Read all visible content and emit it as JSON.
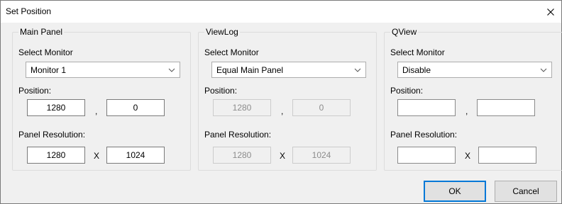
{
  "window": {
    "title": "Set Position"
  },
  "groups": [
    {
      "title": "Main Panel",
      "select_monitor_label": "Select Monitor",
      "monitor_value": "Monitor 1",
      "position_label": "Position:",
      "position_x": "1280",
      "position_sep": ",",
      "position_y": "0",
      "resolution_label": "Panel Resolution:",
      "resolution_w": "1280",
      "resolution_sep": "X",
      "resolution_h": "1024"
    },
    {
      "title": "ViewLog",
      "select_monitor_label": "Select Monitor",
      "monitor_value": "Equal Main Panel",
      "position_label": "Position:",
      "position_x": "1280",
      "position_sep": ",",
      "position_y": "0",
      "resolution_label": "Panel Resolution:",
      "resolution_w": "1280",
      "resolution_sep": "X",
      "resolution_h": "1024"
    },
    {
      "title": "QView",
      "select_monitor_label": "Select Monitor",
      "monitor_value": "Disable",
      "position_label": "Position:",
      "position_x": "",
      "position_sep": ",",
      "position_y": "",
      "resolution_label": "Panel Resolution:",
      "resolution_w": "",
      "resolution_sep": "X",
      "resolution_h": ""
    }
  ],
  "buttons": {
    "ok": "OK",
    "cancel": "Cancel"
  },
  "icons": {
    "close": "close-icon",
    "dropdown": "chevron-down-icon"
  },
  "colors": {
    "default_button_border": "#0078d7",
    "dialog_bg": "#f0f0f0"
  }
}
